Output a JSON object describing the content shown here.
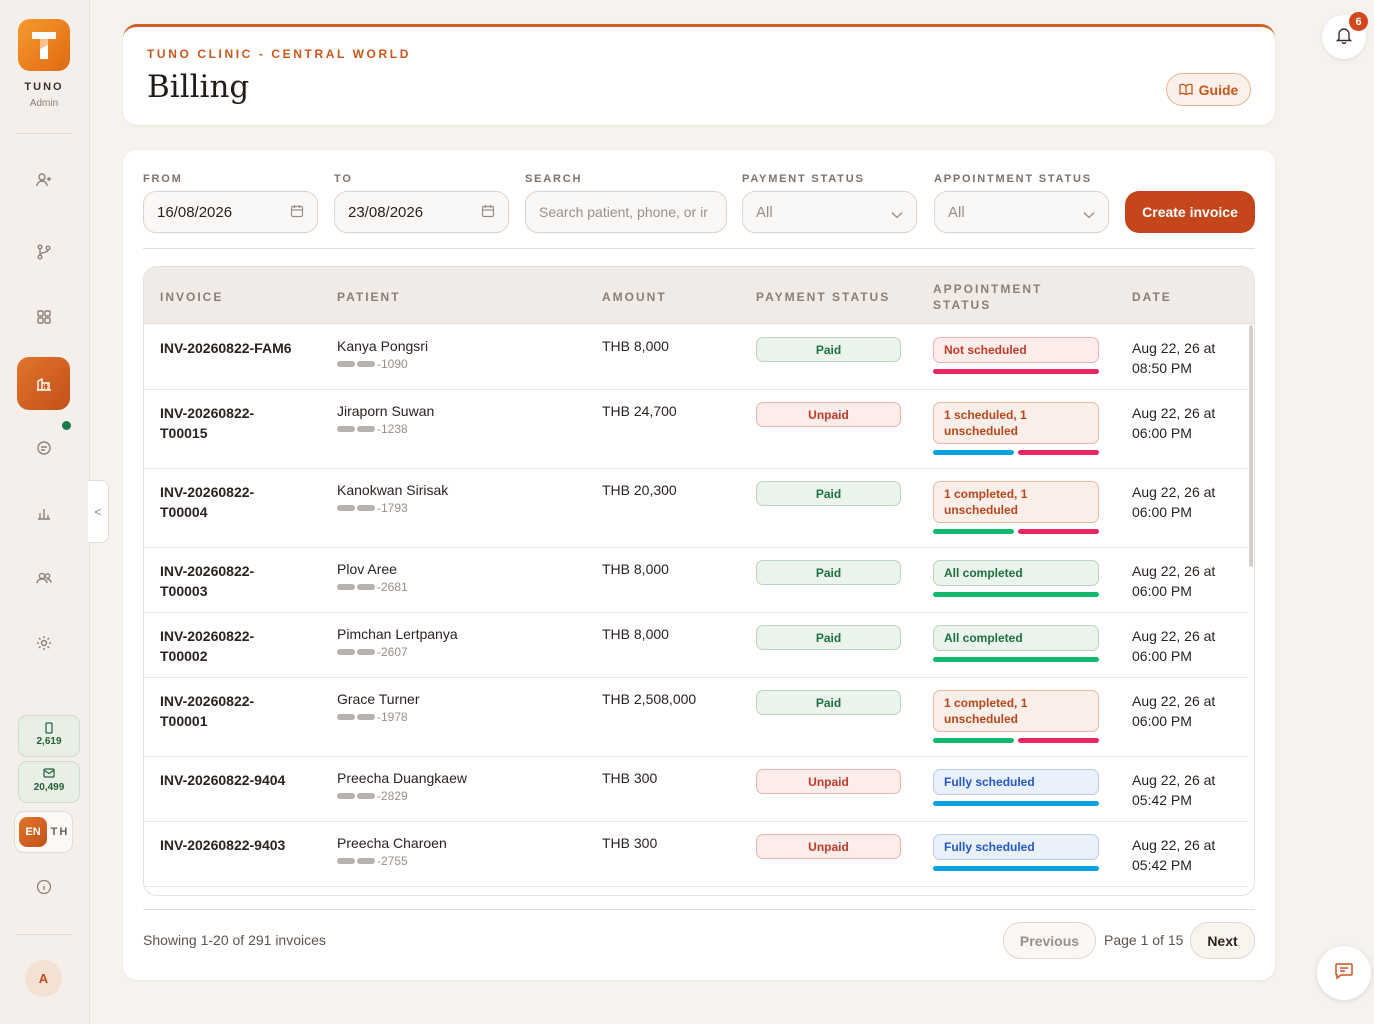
{
  "sidebar": {
    "brand": "TUNO",
    "role": "Admin",
    "sms_credits": "2,619",
    "email_credits": "20,499",
    "lang_en": "EN",
    "lang_th": "TH",
    "avatar_initial": "A",
    "nav_icons": [
      "add-patient-icon",
      "branch-icon",
      "dashboard-grid-icon",
      "billing-icon",
      "chat-icon",
      "reports-icon",
      "users-icon",
      "settings-icon"
    ]
  },
  "header": {
    "clinic": "TUNO CLINIC - CENTRAL WORLD",
    "title": "Billing",
    "guide_label": "Guide"
  },
  "notifications": {
    "count": "6"
  },
  "filters": {
    "from_label": "FROM",
    "from_value": "16/08/2026",
    "to_label": "TO",
    "to_value": "23/08/2026",
    "search_label": "SEARCH",
    "search_placeholder": "Search patient, phone, or ir",
    "payment_label": "PAYMENT STATUS",
    "payment_value": "All",
    "appointment_label": "APPOINTMENT STATUS",
    "appointment_value": "All",
    "create_label": "Create invoice"
  },
  "table": {
    "headers": [
      "INVOICE",
      "PATIENT",
      "AMOUNT",
      "PAYMENT STATUS",
      "APPOINTMENT STATUS",
      "DATE"
    ],
    "rows": [
      {
        "invoice": "INV-20260822-FAM6",
        "patient": "Kanya Pongsri",
        "phone_suffix": "-1090",
        "amount": "THB 8,000",
        "payment": "Paid",
        "appointment": "Not scheduled",
        "date": "Aug 22, 26 at 08:50 PM"
      },
      {
        "invoice": "INV-20260822-T00015",
        "patient": "Jiraporn Suwan",
        "phone_suffix": "-1238",
        "amount": "THB 24,700",
        "payment": "Unpaid",
        "appointment": "1 scheduled, 1 unscheduled",
        "date": "Aug 22, 26 at 06:00 PM"
      },
      {
        "invoice": "INV-20260822-T00004",
        "patient": "Kanokwan Sirisak",
        "phone_suffix": "-1793",
        "amount": "THB 20,300",
        "payment": "Paid",
        "appointment": "1 completed, 1 unscheduled",
        "date": "Aug 22, 26 at 06:00 PM"
      },
      {
        "invoice": "INV-20260822-T00003",
        "patient": "Plov Aree",
        "phone_suffix": "-2681",
        "amount": "THB 8,000",
        "payment": "Paid",
        "appointment": "All completed",
        "date": "Aug 22, 26 at 06:00 PM"
      },
      {
        "invoice": "INV-20260822-T00002",
        "patient": "Pimchan Lertpanya",
        "phone_suffix": "-2607",
        "amount": "THB 8,000",
        "payment": "Paid",
        "appointment": "All completed",
        "date": "Aug 22, 26 at 06:00 PM"
      },
      {
        "invoice": "INV-20260822-T00001",
        "patient": "Grace Turner",
        "phone_suffix": "-1978",
        "amount": "THB 2,508,000",
        "payment": "Paid",
        "appointment": "1 completed, 1 unscheduled",
        "date": "Aug 22, 26 at 06:00 PM"
      },
      {
        "invoice": "INV-20260822-9404",
        "patient": "Preecha Duangkaew",
        "phone_suffix": "-2829",
        "amount": "THB 300",
        "payment": "Unpaid",
        "appointment": "Fully scheduled",
        "date": "Aug 22, 26 at 05:42 PM"
      },
      {
        "invoice": "INV-20260822-9403",
        "patient": "Preecha Charoen",
        "phone_suffix": "-2755",
        "amount": "THB 300",
        "payment": "Unpaid",
        "appointment": "Fully scheduled",
        "date": "Aug 22, 26 at 05:42 PM"
      }
    ]
  },
  "pagination": {
    "summary": "Showing 1-20 of 291 invoices",
    "prev_label": "Previous",
    "page_info": "Page 1 of 15",
    "next_label": "Next"
  },
  "colors": {
    "accent": "#c4461a",
    "paid": "#1e7140",
    "unpaid": "#c23a2a",
    "bar_red": "#ec2763",
    "bar_blue": "#0aa2e0",
    "bar_green": "#12b86e"
  }
}
